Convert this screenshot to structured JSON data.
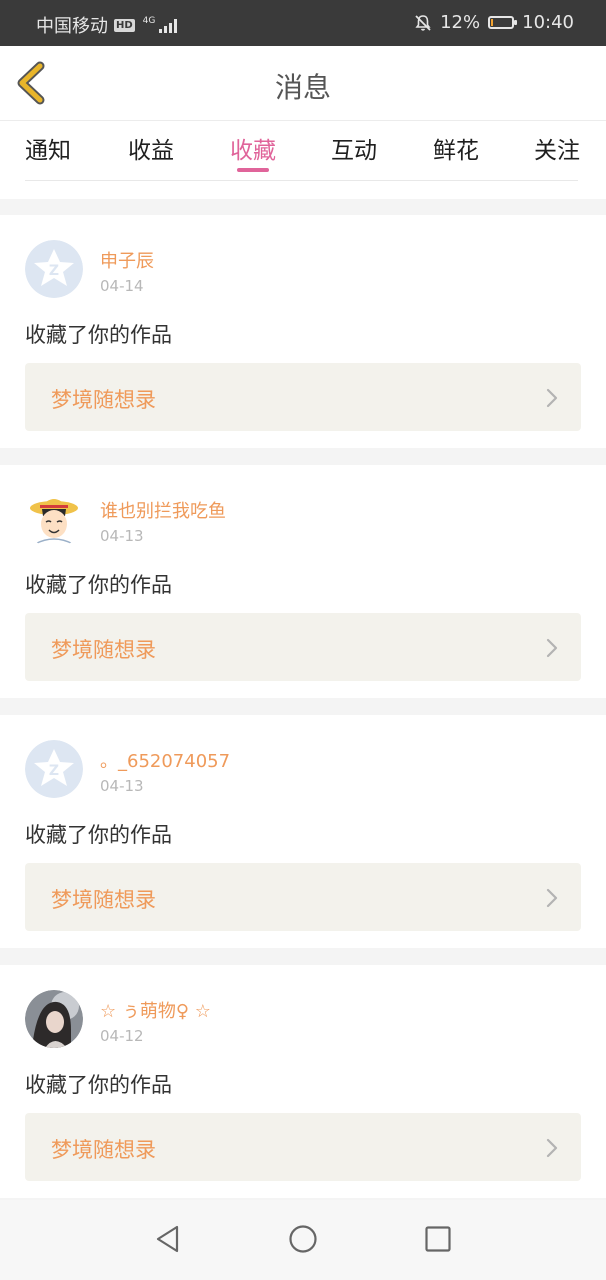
{
  "status_bar": {
    "carrier": "中国移动",
    "hd": "HD",
    "network": "4G",
    "battery": "12%",
    "battery_level": 0.12,
    "time": "10:40"
  },
  "header": {
    "title": "消息"
  },
  "tabs": [
    {
      "label": "通知",
      "active": false
    },
    {
      "label": "收益",
      "active": false
    },
    {
      "label": "收藏",
      "active": true
    },
    {
      "label": "互动",
      "active": false
    },
    {
      "label": "鲜花",
      "active": false
    },
    {
      "label": "关注",
      "active": false
    }
  ],
  "messages": [
    {
      "username": "申子辰",
      "date": "04-14",
      "action": "收藏了你的作品",
      "work": "梦境随想录",
      "avatar": "qq-default-avatar"
    },
    {
      "username": "谁也别拦我吃鱼",
      "date": "04-13",
      "action": "收藏了你的作品",
      "work": "梦境随想录",
      "avatar": "cartoon-avatar"
    },
    {
      "username": "。_652074057",
      "date": "04-13",
      "action": "收藏了你的作品",
      "work": "梦境随想录",
      "avatar": "qq-default-avatar"
    },
    {
      "username": "☆ ぅ萌物♀ ☆",
      "date": "04-12",
      "action": "收藏了你的作品",
      "work": "梦境随想录",
      "avatar": "photo-avatar"
    }
  ],
  "colors": {
    "accent": "#e0649a",
    "username": "#ef9a5a",
    "work_title": "#ef9a5a",
    "work_box": "#f3f2ec",
    "back_chevron": "#e8b52a"
  },
  "icons": {
    "back": "back-chevron-icon",
    "mute": "mute-icon",
    "nav_back": "triangle-back-icon",
    "nav_home": "circle-home-icon",
    "nav_recent": "square-recent-icon"
  }
}
